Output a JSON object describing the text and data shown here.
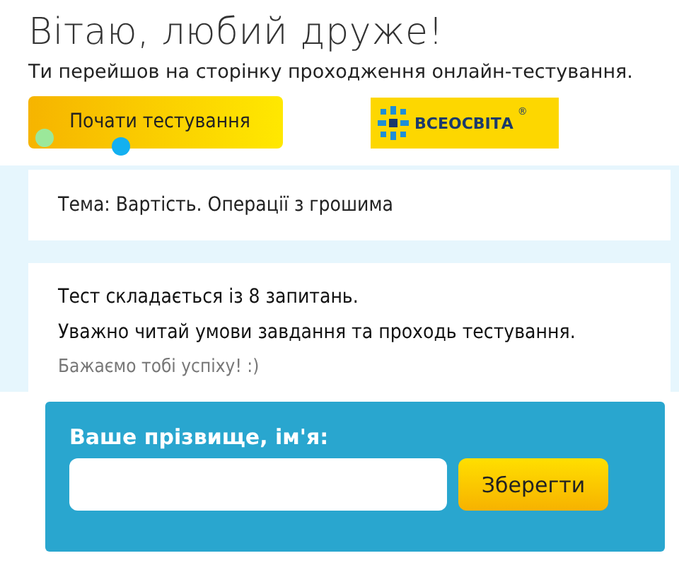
{
  "header": {
    "title": "Вітаю, любий друже!",
    "subtitle": "Ти перейшов на сторінку проходження онлайн-тестування."
  },
  "start_button": {
    "label": "Почати тестування"
  },
  "logo": {
    "text": "ВСЕОСВІТА",
    "mark": "®"
  },
  "topic": "Тема: Вартість. Операції з грошима",
  "info": [
    {
      "text": "Тест складається із 8 запитань.",
      "kind": "main"
    },
    {
      "text": "Уважно читай умови завдання та проходь тестування.",
      "kind": "main"
    },
    {
      "text": "Бажаємо тобі успіху! :)",
      "kind": "muted"
    }
  ],
  "form": {
    "label": "Ваше прізвище, ім'я:",
    "button": "Зберегти"
  }
}
